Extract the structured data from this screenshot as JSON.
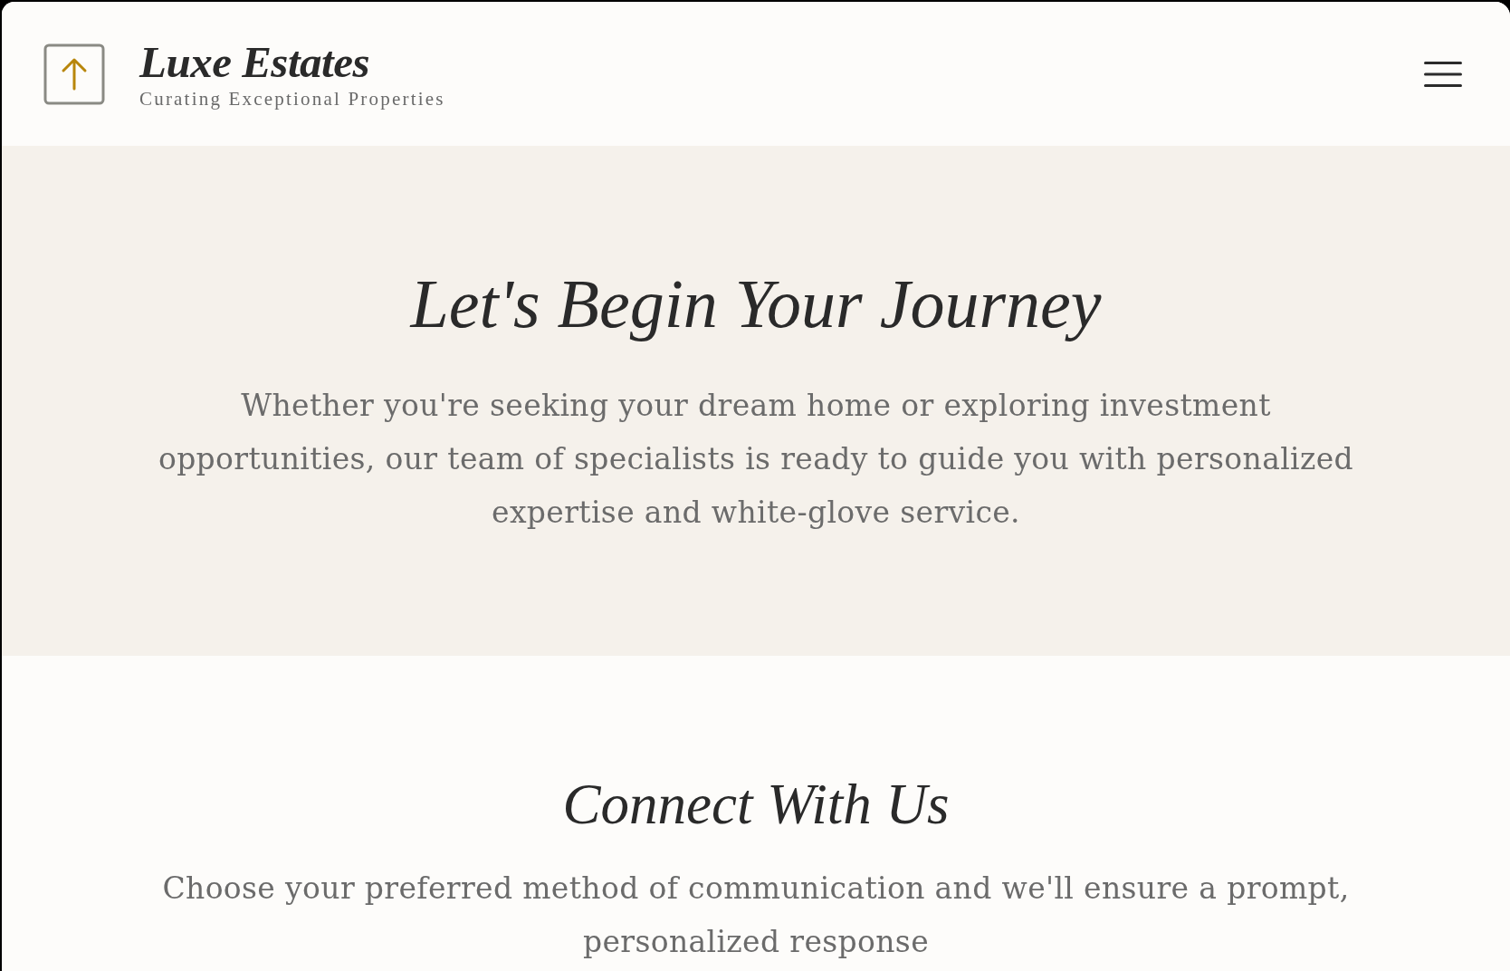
{
  "header": {
    "brand": {
      "name": "Luxe Estates",
      "tagline": "Curating Exceptional Properties"
    }
  },
  "hero": {
    "title": "Let's Begin Your Journey",
    "text": "Whether you're seeking your dream home or exploring investment opportunities, our team of specialists is ready to guide you with personalized expertise and white-glove service."
  },
  "contact": {
    "title": "Connect With Us",
    "text": "Choose your preferred method of communication and we'll ensure a prompt, personalized response"
  }
}
